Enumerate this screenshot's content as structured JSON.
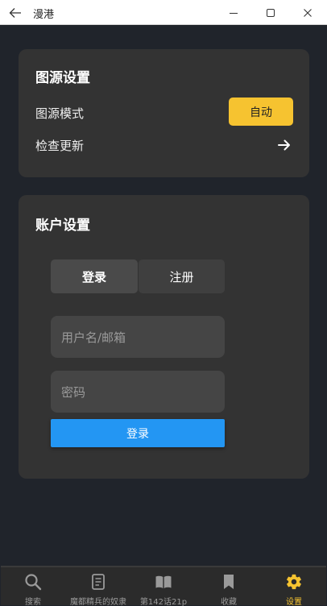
{
  "window": {
    "title": "漫港",
    "back_icon": "arrow-left-icon",
    "minimize_icon": "minimize-icon",
    "maximize_icon": "maximize-icon",
    "close_icon": "close-icon"
  },
  "source_settings": {
    "title": "图源设置",
    "mode_label": "图源模式",
    "mode_value": "自动",
    "update_label": "检查更新",
    "update_icon": "arrow-right-icon"
  },
  "account_settings": {
    "title": "账户设置",
    "tabs": [
      {
        "label": "登录",
        "active": true
      },
      {
        "label": "注册",
        "active": false
      }
    ],
    "username_placeholder": "用户名/邮箱",
    "password_placeholder": "密码",
    "submit_label": "登录"
  },
  "bottom_nav": {
    "items": [
      {
        "label": "搜索",
        "icon": "search-icon",
        "active": false
      },
      {
        "label": "魔都精兵的奴隶",
        "icon": "document-icon",
        "active": false
      },
      {
        "label": "第142话21p",
        "icon": "book-icon",
        "active": false
      },
      {
        "label": "收藏",
        "icon": "bookmark-icon",
        "active": false
      },
      {
        "label": "设置",
        "icon": "gear-icon",
        "active": true
      }
    ]
  },
  "colors": {
    "accent_yellow": "#f6c330",
    "primary_blue": "#2396f3",
    "background": "#20242b",
    "card": "#333333"
  }
}
